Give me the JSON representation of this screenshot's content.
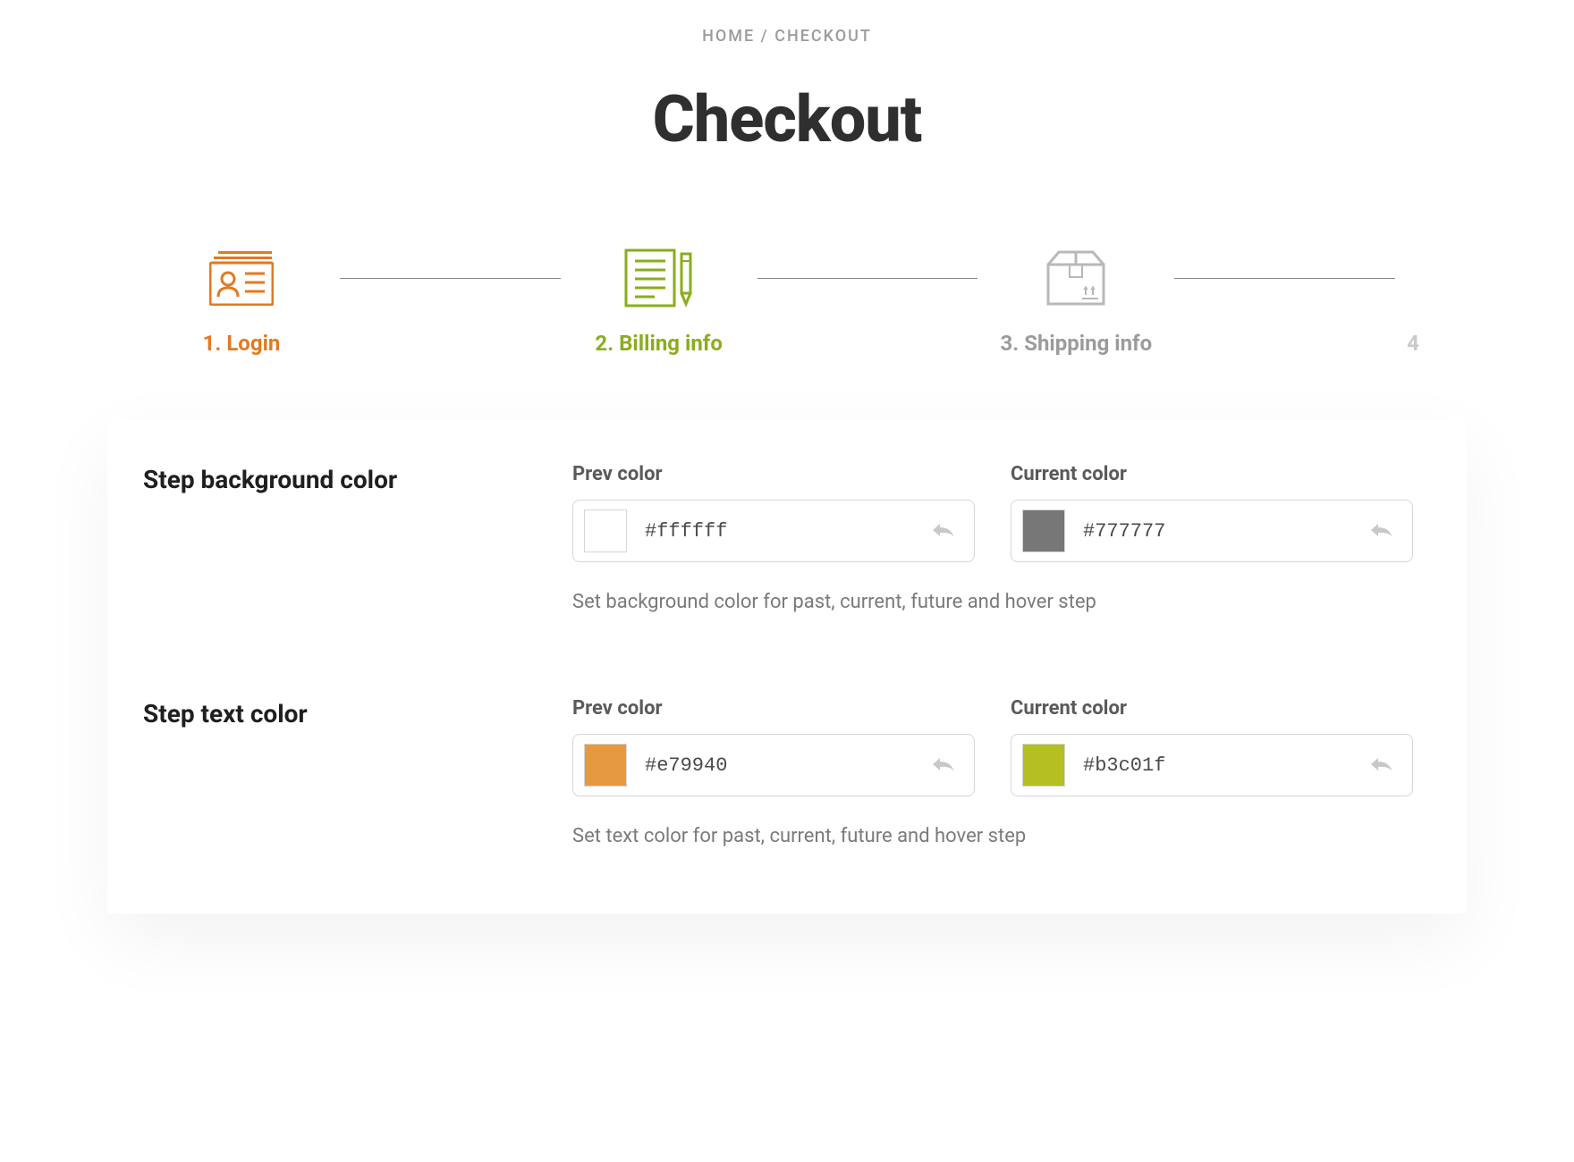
{
  "breadcrumb": {
    "home": "HOME",
    "separator": " / ",
    "current": "CHECKOUT"
  },
  "page_title": "Checkout",
  "steps": [
    {
      "label": "1. Login",
      "state": "past"
    },
    {
      "label": "2. Billing info",
      "state": "current"
    },
    {
      "label": "3. Shipping info",
      "state": "future"
    },
    {
      "label": "4",
      "state": "clipped"
    }
  ],
  "settings": {
    "bg_color": {
      "title": "Step background color",
      "prev": {
        "label": "Prev color",
        "value": "#ffffff",
        "swatch": "#ffffff"
      },
      "current": {
        "label": "Current color",
        "value": "#777777",
        "swatch": "#777777"
      },
      "desc": "Set background color for past, current, future and hover step"
    },
    "text_color": {
      "title": "Step text color",
      "prev": {
        "label": "Prev color",
        "value": "#e79940",
        "swatch": "#e79940"
      },
      "current": {
        "label": "Current color",
        "value": "#b3c01f",
        "swatch": "#b3c01f"
      },
      "desc": "Set text color for past, current, future and hover step"
    }
  },
  "colors": {
    "past": "#e17a1f",
    "current_step": "#8aad1e",
    "future": "#9b9b9b"
  }
}
